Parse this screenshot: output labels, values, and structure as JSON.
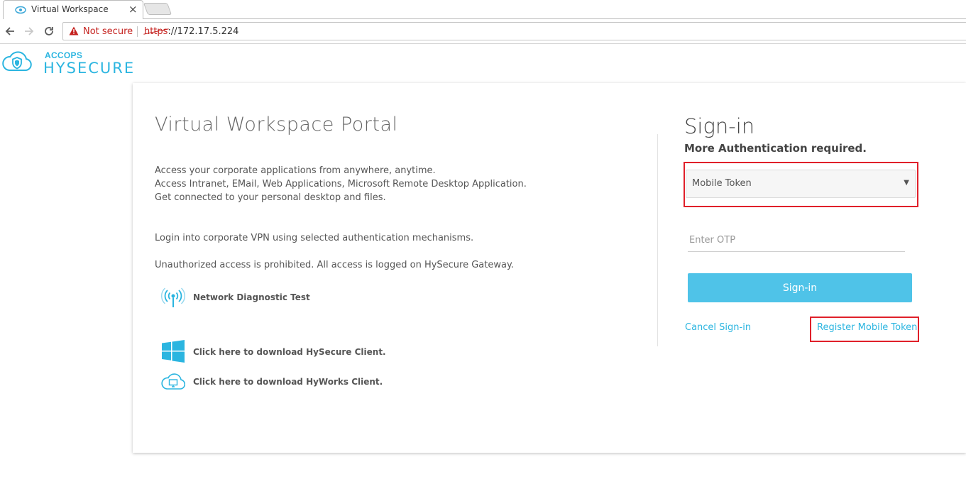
{
  "browser": {
    "tab_title": "Virtual Workspace",
    "tab_close": "×",
    "security_label": "Not secure",
    "url_scheme": "https",
    "url_rest": "://172.17.5.224"
  },
  "logo": {
    "brand_top": "ACCOPS",
    "brand_main": "HYSECURE"
  },
  "portal": {
    "title": "Virtual Workspace Portal",
    "description_lines": [
      "Access your corporate applications from anywhere, anytime.",
      "Access Intranet, EMail, Web Applications, Microsoft Remote Desktop Application.",
      "Get connected to your personal desktop and files."
    ],
    "vpn_note": "Login into corporate VPN using selected authentication mechanisms.",
    "warning_note": "Unauthorized access is prohibited. All access is logged on HySecure Gateway.",
    "links": {
      "diagnostic": "Network Diagnostic Test",
      "hysecure_client": "Click here to download HySecure Client.",
      "hyworks_client": "Click here to download HyWorks Client."
    }
  },
  "signin": {
    "title": "Sign-in",
    "subtitle": "More Authentication required.",
    "method_selected": "Mobile Token",
    "otp_placeholder": "Enter OTP",
    "submit_label": "Sign-in",
    "cancel_label": "Cancel Sign-in",
    "register_label": "Register Mobile Token"
  },
  "colors": {
    "accent": "#4fc3e8",
    "link": "#2bb5e0",
    "highlight": "#e0202a",
    "insecure": "#c5221f"
  }
}
